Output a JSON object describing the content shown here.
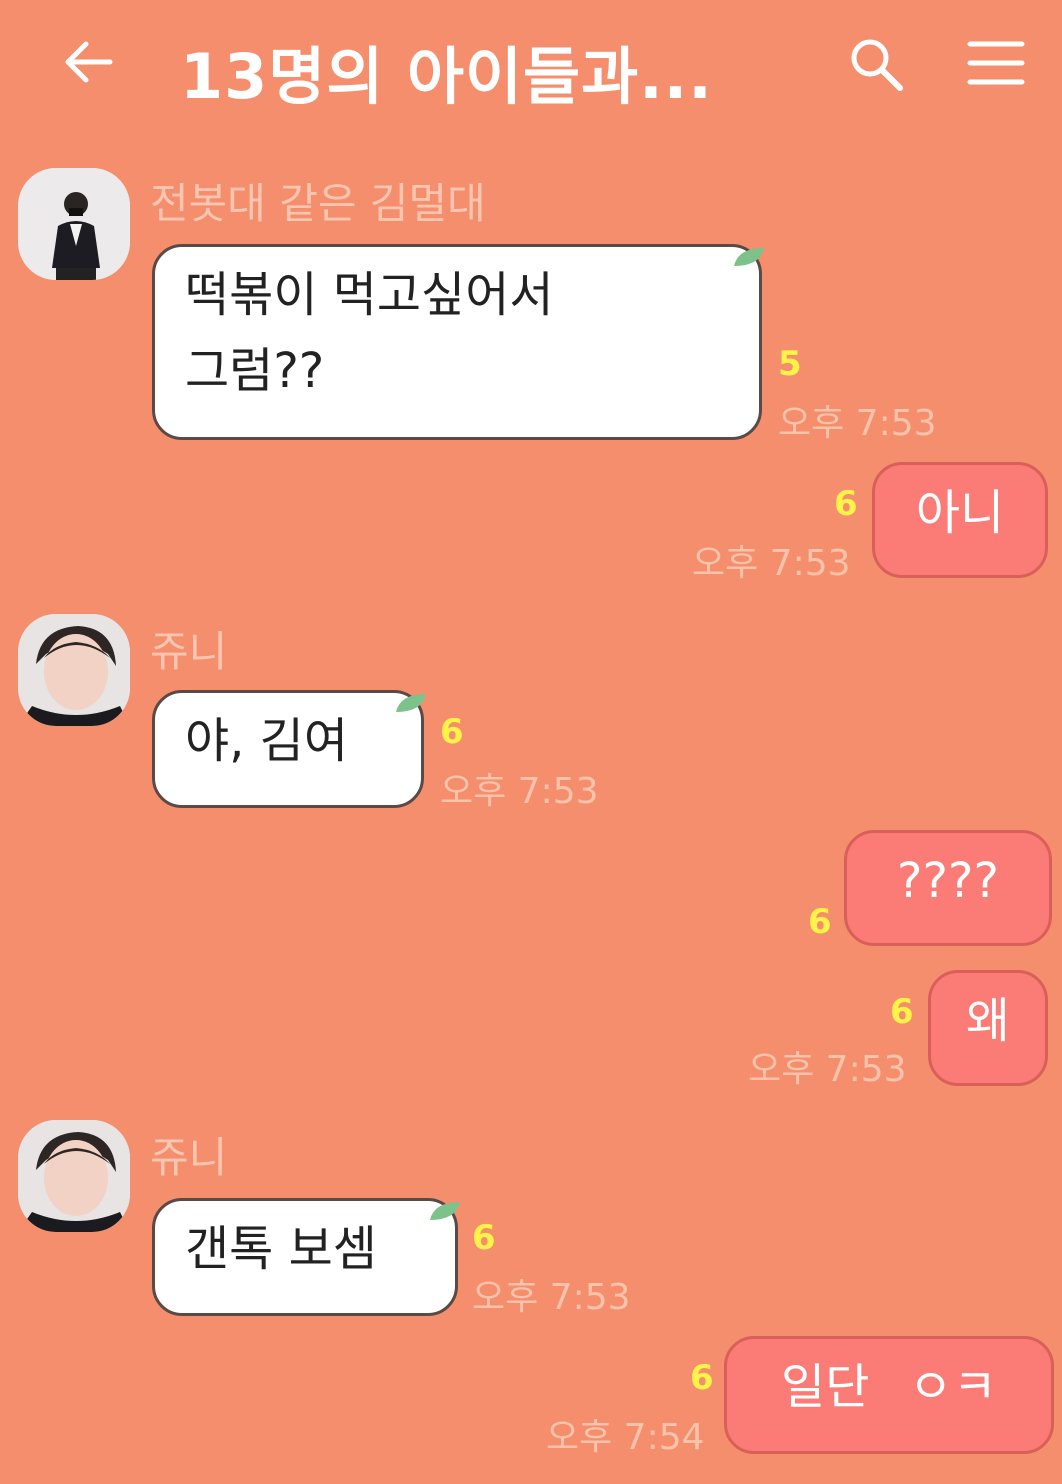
{
  "colors": {
    "background": "#f58e6c",
    "incoming_bubble": "#ffffff",
    "outgoing_bubble": "#fb7c77",
    "unread_count": "#fff34a"
  },
  "header": {
    "title": "13명의 아이들과...",
    "back_icon": "arrow-left-icon",
    "search_icon": "search-icon",
    "menu_icon": "hamburger-menu-icon"
  },
  "messages": [
    {
      "direction": "in",
      "sender": "전봇대 같은 김멀대",
      "text_lines": [
        "떡볶이 먹고싶어서",
        "그럼??"
      ],
      "unread": "5",
      "time": "오후 7:53"
    },
    {
      "direction": "out",
      "text": "아니",
      "unread": "6",
      "time": "오후 7:53"
    },
    {
      "direction": "in",
      "sender": "쥬니",
      "text": "야, 김여",
      "unread": "6",
      "time": "오후 7:53"
    },
    {
      "direction": "out",
      "text": "????",
      "unread": "6",
      "time": ""
    },
    {
      "direction": "out",
      "text": "왜",
      "unread": "6",
      "time": "오후 7:53"
    },
    {
      "direction": "in",
      "sender": "쥬니",
      "text": "갠톡 보셈",
      "unread": "6",
      "time": "오후 7:53"
    },
    {
      "direction": "out",
      "text": "일단 ㅇㅋ",
      "unread": "6",
      "time": "오후 7:54"
    }
  ]
}
